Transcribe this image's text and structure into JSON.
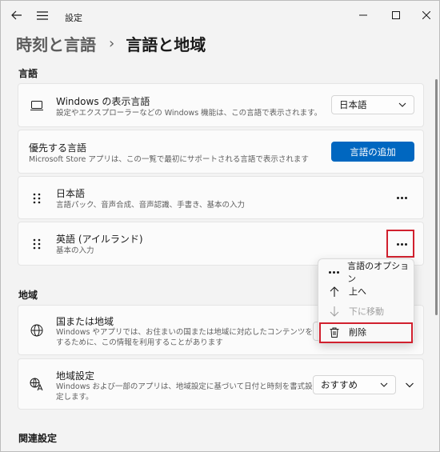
{
  "titlebar": {
    "title": "設定"
  },
  "header": {
    "parent": "時刻と言語",
    "separator": "›",
    "current": "言語と地域"
  },
  "sections": {
    "language": "言語",
    "region": "地域",
    "related": "関連設定"
  },
  "display_language": {
    "title": "Windows の表示言語",
    "desc": "設定やエクスプローラーなどの Windows 機能は、この言語で表示されます。",
    "value": "日本語"
  },
  "preferred": {
    "title": "優先する言語",
    "desc": "Microsoft Store アプリは、この一覧で最初にサポートされる言語で表示されます",
    "add_button": "言語の追加"
  },
  "languages": [
    {
      "name": "日本語",
      "desc": "言語パック、音声合成、音声認識、手書き、基本の入力"
    },
    {
      "name": "英語 (アイルランド)",
      "desc": "基本の入力"
    }
  ],
  "context_menu": {
    "items": [
      {
        "label": "言語のオプション",
        "icon": "more-icon",
        "enabled": true
      },
      {
        "label": "上へ",
        "icon": "arrow-up-icon",
        "enabled": true
      },
      {
        "label": "下に移動",
        "icon": "arrow-down-icon",
        "enabled": false
      },
      {
        "label": "削除",
        "icon": "trash-icon",
        "enabled": true
      }
    ]
  },
  "country": {
    "title": "国または地域",
    "desc": "Windows やアプリでは、お住まいの国または地域に対応したコンテンツを提供するために、この情報を利用することがあります"
  },
  "regional_format": {
    "title": "地域設定",
    "desc": "Windows および一部のアプリは、地域設定に基づいて日付と時刻を書式設定します。",
    "value": "おすすめ"
  },
  "colors": {
    "accent": "#0067c0",
    "highlight": "#d1202e"
  }
}
